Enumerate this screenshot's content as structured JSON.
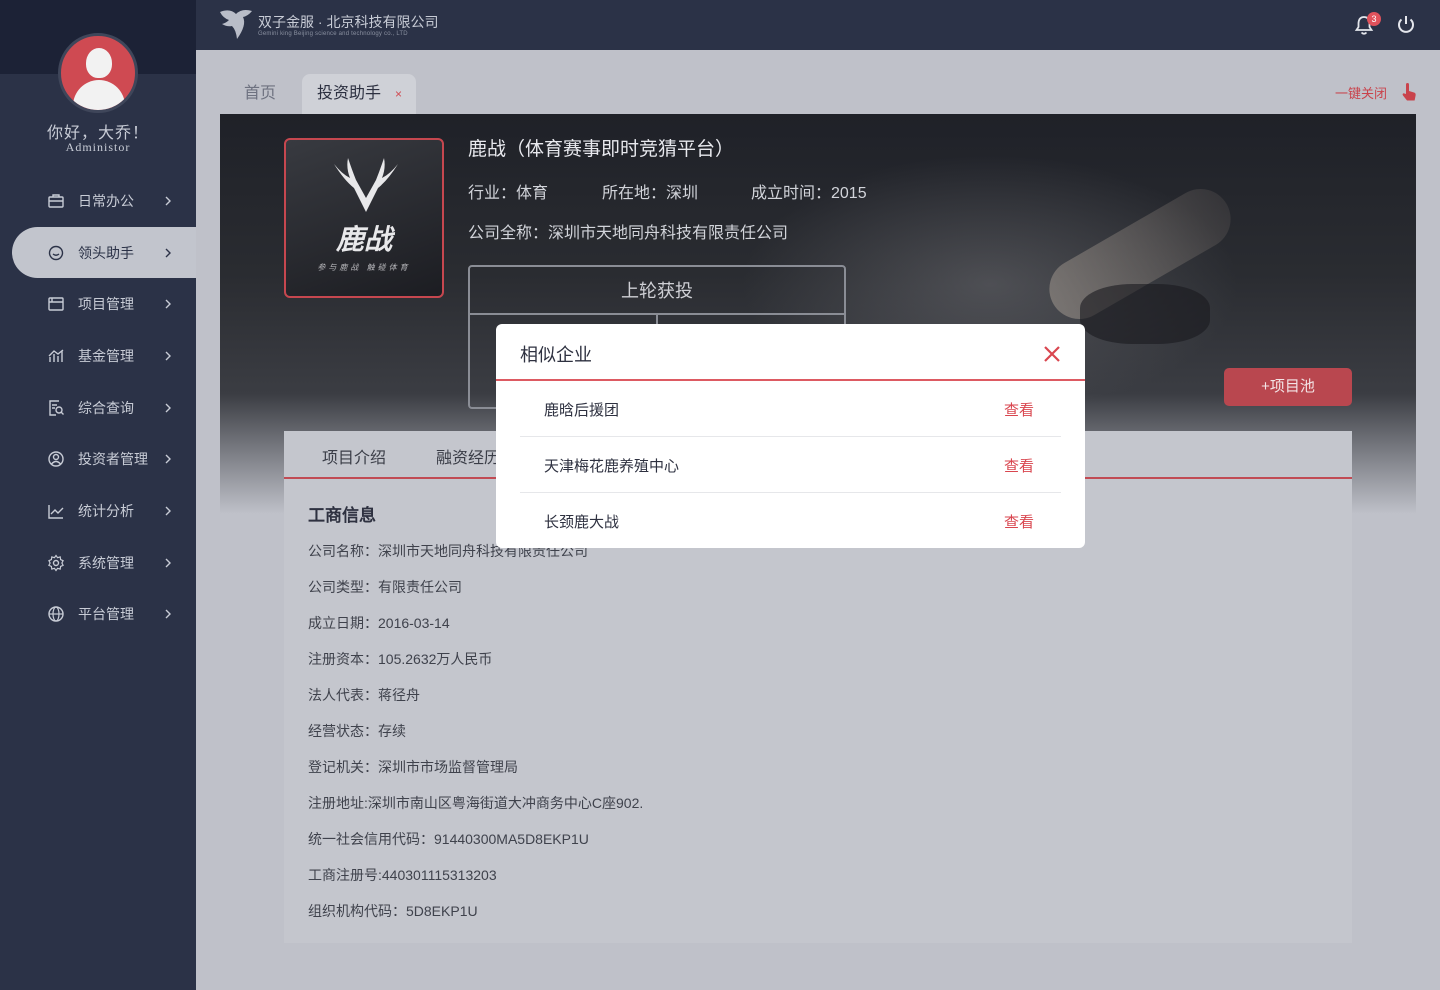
{
  "app": {
    "company_name": "双子金服 · 北京科技有限公司",
    "company_subtitle": "Gemini king Beijing science and technology co., LTD",
    "notification_count": "3"
  },
  "user": {
    "greeting": "你好，大乔！",
    "role": "Administor"
  },
  "sidebar": {
    "items": [
      {
        "label": "日常办公",
        "icon": "briefcase-icon",
        "active": false
      },
      {
        "label": "领头助手",
        "icon": "chat-icon",
        "active": true
      },
      {
        "label": "项目管理",
        "icon": "window-icon",
        "active": false
      },
      {
        "label": "基金管理",
        "icon": "trend-icon",
        "active": false
      },
      {
        "label": "综合查询",
        "icon": "doc-search-icon",
        "active": false
      },
      {
        "label": "投资者管理",
        "icon": "user-circle-icon",
        "active": false
      },
      {
        "label": "统计分析",
        "icon": "line-chart-icon",
        "active": false
      },
      {
        "label": "系统管理",
        "icon": "gear-icon",
        "active": false
      },
      {
        "label": "平台管理",
        "icon": "globe-icon",
        "active": false
      }
    ]
  },
  "tabs": {
    "home": "首页",
    "active": "投资助手",
    "active_close": "×",
    "close_all": "一键关闭"
  },
  "company": {
    "title": "鹿战（体育赛事即时竞猜平台）",
    "industry": "行业：体育",
    "location": "所在地：深圳",
    "founded": "成立时间：2015",
    "full_name": "公司全称：深圳市天地同舟科技有限责任公司",
    "logo_name": "鹿战",
    "logo_slogan": "参与鹿战 触碰体育",
    "last_round_title": "上轮获投",
    "add_pool": "+项目池"
  },
  "detail": {
    "tabs": [
      "项目介绍",
      "融资经历"
    ],
    "section_title": "工商信息",
    "rows": [
      "公司名称：深圳市天地同舟科技有限责任公司",
      "公司类型：有限责任公司",
      "成立日期：2016-03-14",
      "注册资本：105.2632万人民币",
      "法人代表：蒋径舟",
      "经营状态：存续",
      "登记机关：深圳市市场监督管理局",
      "注册地址:深圳市南山区粤海街道大冲商务中心C座902.",
      "统一社会信用代码：91440300MA5D8EKP1U",
      "工商注册号:440301115313203",
      "组织机构代码：5D8EKP1U"
    ]
  },
  "modal": {
    "title": "相似企业",
    "rows": [
      {
        "name": "鹿晗后援团",
        "action": "查看"
      },
      {
        "name": "天津梅花鹿养殖中心",
        "action": "查看"
      },
      {
        "name": "长颈鹿大战",
        "action": "查看"
      }
    ]
  },
  "colors": {
    "accent": "#d9464f",
    "sidebar_bg": "#2b3247",
    "content_dimmed": "#bfc1c9"
  }
}
